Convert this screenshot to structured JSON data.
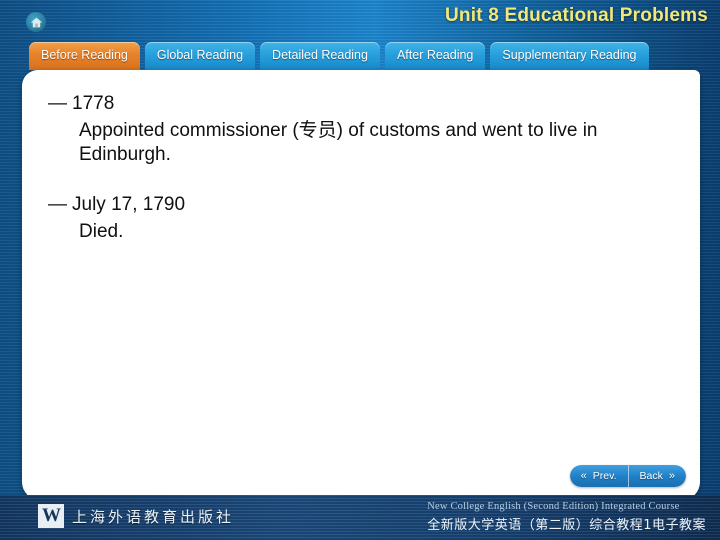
{
  "header": {
    "home_icon": "home-icon",
    "deck_title": "Unit 8 Educational Problems"
  },
  "tabs": [
    {
      "label": "Before Reading",
      "active": true
    },
    {
      "label": "Global Reading",
      "active": false
    },
    {
      "label": "Detailed Reading",
      "active": false
    },
    {
      "label": "After Reading",
      "active": false
    },
    {
      "label": "Supplementary Reading",
      "active": false
    }
  ],
  "content": {
    "blocks": [
      {
        "dash": "—",
        "head": "1778",
        "sub": "Appointed commissioner (专员) of customs and went to live in Edinburgh."
      },
      {
        "dash": "—",
        "head": "July 17, 1790",
        "sub": "Died."
      }
    ]
  },
  "nav": {
    "prev_label": "Prev.",
    "prev_icon": "double-chevron-left-icon",
    "back_label": "Back",
    "back_icon": "double-chevron-right-icon",
    "prev_chevron": "«",
    "back_chevron": "»"
  },
  "footer": {
    "publisher_mark": "W",
    "publisher_name": "上海外语教育出版社",
    "course_en": "New College English (Second Edition) Integrated Course",
    "course_cn": "全新版大学英语（第二版）综合教程1电子教案"
  },
  "colors": {
    "background_blue": "#1472b8",
    "active_tab_orange": "#e8822a",
    "inactive_tab_blue": "#28a0dc",
    "title_yellow": "#f2e87a",
    "panel_white": "#ffffff",
    "footer_navy": "#1d4c80"
  }
}
